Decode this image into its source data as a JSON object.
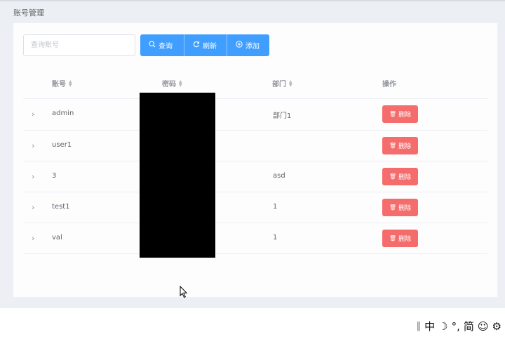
{
  "page": {
    "title": "账号管理"
  },
  "toolbar": {
    "search_placeholder": "查询账号",
    "query_label": "查询",
    "refresh_label": "刷新",
    "add_label": "添加"
  },
  "table": {
    "headers": {
      "account": "账号",
      "password": "密码",
      "department": "部门",
      "actions": "操作"
    },
    "rows": [
      {
        "account": "admin",
        "department": "部门1",
        "action": "删除"
      },
      {
        "account": "user1",
        "department": "",
        "action": "删除"
      },
      {
        "account": "3",
        "department": "asd",
        "action": "删除"
      },
      {
        "account": "test1",
        "department": "1",
        "action": "删除"
      },
      {
        "account": "val",
        "department": "1",
        "action": "删除"
      }
    ]
  },
  "ime": {
    "mode": "中",
    "punct": "°,",
    "script": "简"
  },
  "colors": {
    "primary": "#409eff",
    "danger": "#f56c6c",
    "panel": "#fdfdfe",
    "background": "#eceff4"
  }
}
